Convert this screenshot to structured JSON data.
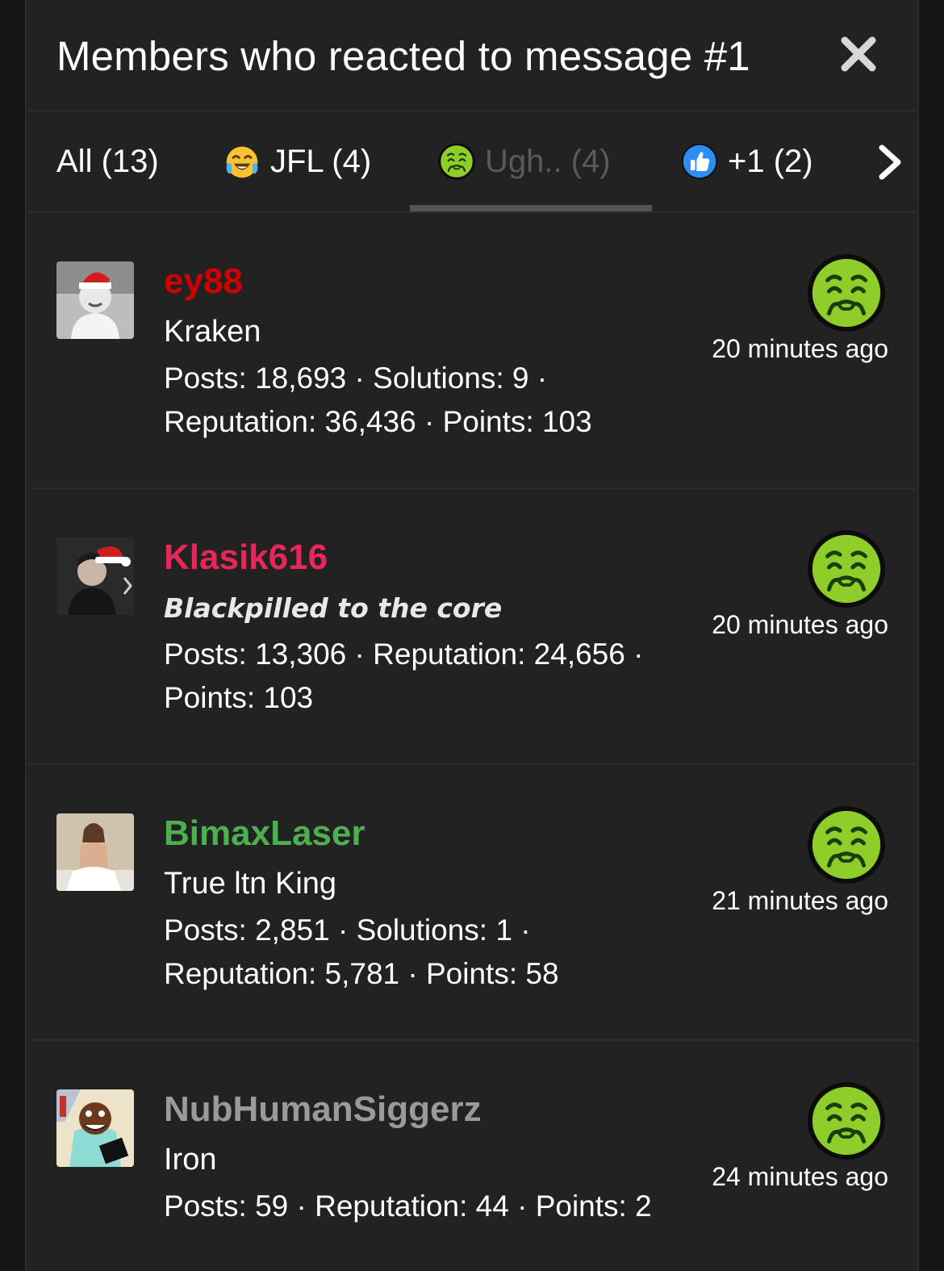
{
  "dialog": {
    "title": "Members who reacted to message #1",
    "close_icon": "close-icon"
  },
  "tabs": [
    {
      "label": "All (13)",
      "icon": null,
      "active": false
    },
    {
      "label": "JFL (4)",
      "icon": "tears-of-joy-emoji",
      "active": false
    },
    {
      "label": "Ugh.. (4)",
      "icon": "nauseated-emoji",
      "active": true
    },
    {
      "label": "+1 (2)",
      "icon": "thumbs-up-icon",
      "active": false
    }
  ],
  "tabs_next_icon": "chevron-right-icon",
  "members": [
    {
      "username": "ey88",
      "username_color": "#d00000",
      "user_title": "Kraken",
      "stats_line1": "Posts: 18,693 · Solutions: 9 ·",
      "stats_line2": "Reputation: 36,436 · Points: 103",
      "reaction_icon": "nauseated-emoji",
      "time": "20 minutes ago"
    },
    {
      "username": "Klasik616",
      "username_color": "#e8265a",
      "user_title": "Blackpilled to the core",
      "stats_line1": "Posts: 13,306 · Reputation: 24,656 ·",
      "stats_line2": "Points: 103",
      "reaction_icon": "nauseated-emoji",
      "time": "20 minutes ago"
    },
    {
      "username": "BimaxLaser",
      "username_color": "#4caf50",
      "user_title": "True ltn King",
      "stats_line1": "Posts: 2,851 · Solutions: 1 ·",
      "stats_line2": "Reputation: 5,781 · Points: 58",
      "reaction_icon": "nauseated-emoji",
      "time": "21 minutes ago"
    },
    {
      "username": "NubHumanSiggerz",
      "username_color": "#9a9a9a",
      "user_title": "Iron",
      "stats_line1": "Posts: 59 · Reputation: 44 · Points: 2",
      "stats_line2": "",
      "reaction_icon": "nauseated-emoji",
      "time": "24 minutes ago"
    }
  ],
  "colors": {
    "panel_bg": "#222222",
    "divider": "#2c2c2c",
    "active_tab_text": "#5a5a5a",
    "nauseated_face": "#8fce2a"
  }
}
